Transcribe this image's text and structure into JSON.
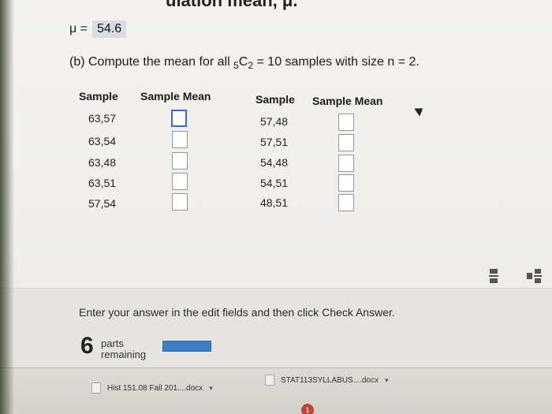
{
  "header": {
    "cut_text": "ulation mean, μ.",
    "mu_label": "μ =",
    "mu_value": "54.6"
  },
  "question": {
    "prefix": "(b) Compute the mean for all",
    "combo_left": "5",
    "combo_letter": "C",
    "combo_right": "2",
    "suffix": "= 10 samples with size n = 2."
  },
  "table": {
    "left": {
      "col_sample": "Sample",
      "col_mean": "Sample Mean",
      "rows": [
        "63,57",
        "63,54",
        "63,48",
        "63,51",
        "57,54"
      ]
    },
    "right": {
      "col_sample": "Sample",
      "col_mean": "Sample Mean",
      "rows": [
        "57,48",
        "57,51",
        "54,48",
        "54,51",
        "48,51"
      ]
    }
  },
  "footer": {
    "instruction": "Enter your answer in the edit fields and then click Check Answer.",
    "parts_count": "6",
    "parts_label_1": "parts",
    "parts_label_2": "remaining",
    "progress_color": "#3c7fc4"
  },
  "downloads": {
    "item1": "Hist 151.08 Fall 201....docx",
    "item2": "STAT113SYLLABUS....docx"
  },
  "taskbar": {
    "badge": "1"
  },
  "colors": {
    "accent_box_border": "#3a6bc2",
    "mu_highlight": "#d9dde3"
  }
}
